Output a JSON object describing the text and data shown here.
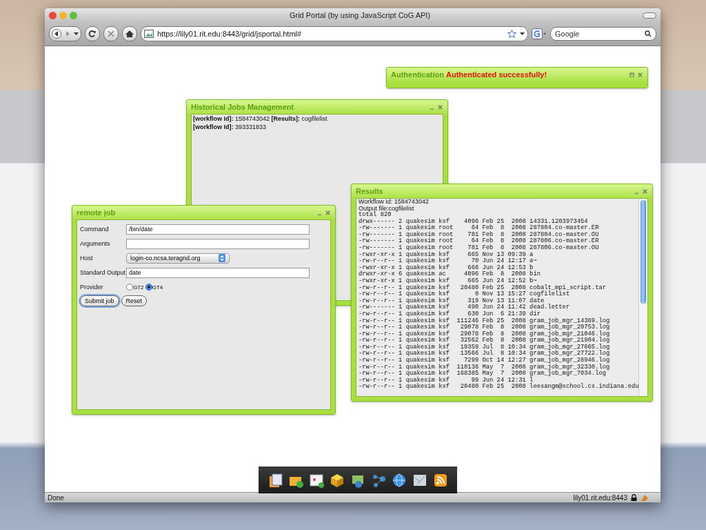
{
  "browser": {
    "title": "Grid Portal (by using JavaScript CoG API)",
    "url": "https://lily01.rit.edu:8443/grid/jsportal.html#",
    "search": {
      "placeholder": "Google"
    }
  },
  "authentication": {
    "title": "Authentication",
    "message": "Authenticated successfully!"
  },
  "history": {
    "title": "Historical Jobs Management",
    "entries": [
      "**[workflow Id]:** 1584743042 **[Results]:** cogfilelist",
      "**[workflow Id]:** 393331833"
    ]
  },
  "results": {
    "title": "Results",
    "header": [
      "Workflow Id: 1584743042",
      "Output file:cogfilelist"
    ],
    "lines": [
      "total 820",
      "drwx------ 2 quakesim ksf    4096 Feb 25  2008 14331.1203973454",
      "-rw------- 1 quakesim root     64 Feb  8  2008 287804.co-master.ER",
      "-rw------- 1 quakesim root    781 Feb  8  2008 287804.co-master.OU",
      "-rw------- 1 quakesim root     64 Feb  8  2008 287806.co-master.ER",
      "-rw------- 1 quakesim root    781 Feb  8  2008 287806.co-master.OU",
      "-rwxr-xr-x 1 quakesim ksf     665 Nov 13 09:39 a",
      "-rw-r--r-- 1 quakesim ksf      70 Jun 24 12:17 a~",
      "-rwxr-xr-x 1 quakesim ksf     666 Jun 24 12:53 b",
      "drwxr-xr-x 6 quakesim ac     4096 Feb  8  2008 bin",
      "-rwxr-xr-x 1 quakesim ksf     665 Jun 24 12:52 b~",
      "-rw-r--r-- 1 quakesim ksf   20480 Feb 25  2008 cobalt_mpi_script.tar",
      "-rw-r--r-- 1 quakesim ksf       0 Nov 13 15:27 cogfilelist",
      "-rw-r--r-- 1 quakesim ksf     319 Nov 13 11:07 date",
      "-rw------- 1 quakesim ksf     490 Jun 24 11:42 dead.letter",
      "-rw-r--r-- 1 quakesim ksf     630 Jun  6 21:39 dir",
      "-rw-r--r-- 1 quakesim ksf  111246 Feb 25  2008 gram_job_mgr_14369.log",
      "-rw-r--r-- 1 quakesim ksf   29078 Feb  8  2008 gram_job_mgr_20753.log",
      "-rw-r--r-- 1 quakesim ksf   29078 Feb  8  2008 gram_job_mgr_21046.log",
      "-rw-r--r-- 1 quakesim ksf   32562 Feb  8  2008 gram_job_mgr_21904.log",
      "-rw-r--r-- 1 quakesim ksf   19359 Jul  8 10:34 gram_job_mgr_27665.log",
      "-rw-r--r-- 1 quakesim ksf   13566 Jul  8 10:34 gram_job_mgr_27722.log",
      "-rw-r--r-- 1 quakesim ksf    7299 Oct 14 12:27 gram_job_mgr_28946.log",
      "-rw-r--r-- 1 quakesim ksf  110136 May  7  2008 gram_job_mgr_32330.log",
      "-rw-r--r-- 1 quakesim ksf  168385 May  7  2008 gram_job_mgr_7034.log",
      "-rw-r--r-- 1 quakesim ksf      99 Jun 24 12:31 l",
      "-rw-r--r-- 1 quakesim ksf   20480 Feb 25  2008 leesangm@school.cs.indiana.edu"
    ]
  },
  "remote_job": {
    "title": "remote job",
    "fields": [
      {
        "kind": "text",
        "label": "Command",
        "value": "/bin/date"
      },
      {
        "kind": "text",
        "label": "Arguments"
      },
      {
        "kind": "select",
        "label": "Host",
        "value": "login-co.ncsa.teragrid.org"
      },
      {
        "kind": "text",
        "label": "Standard Output",
        "value": "date"
      },
      {
        "kind": "radio",
        "label": "Provider",
        "options": [
          {
            "label": "GT2",
            "selected": false
          },
          {
            "label": "GT4",
            "selected": true
          }
        ]
      }
    ],
    "buttons": [
      {
        "label": "Submit job",
        "focused": true
      },
      {
        "label": "Reset",
        "focused": false
      }
    ]
  },
  "status_bar": {
    "text": "Done",
    "host": "lily01.rit.edu:8443"
  }
}
